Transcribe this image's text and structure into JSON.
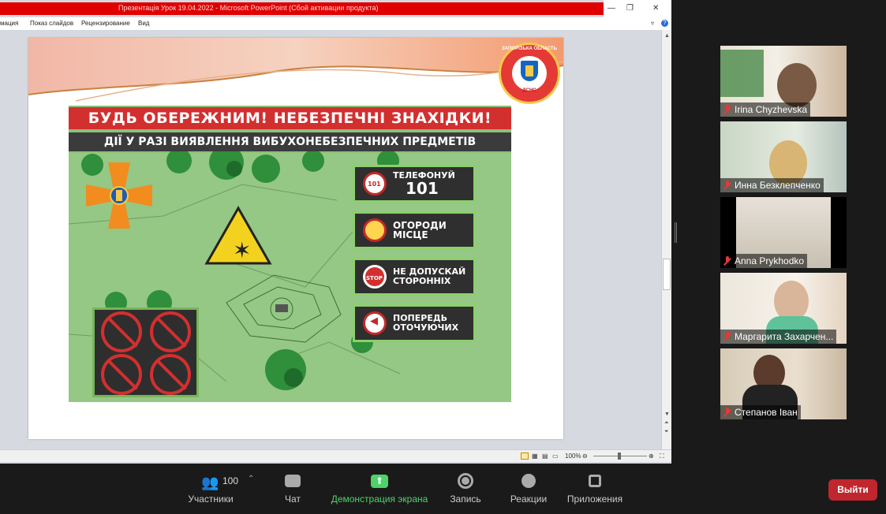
{
  "ppt": {
    "title": "Презентація Урок 19.04.2022  -  Microsoft PowerPoint (Сбой активации продукта)",
    "menu": [
      "мация",
      "Показ слайдов",
      "Рецензирование",
      "Вид"
    ],
    "zoom": "100%"
  },
  "slide": {
    "badge_text": "ЗАПОРІЗЬКА ОБЛАСТЬ",
    "badge_sub": "ДСНС",
    "headline": "БУДЬ ОБЕРЕЖНИМ! НЕБЕЗПЕЧНІ ЗНАХІДКИ!",
    "subheadline": "ДІЇ У РАЗІ ВИЯВЛЕННЯ ВИБУХОНЕБЕЗПЕЧНИХ ПРЕДМЕТІВ",
    "actions": [
      {
        "line1": "ТЕЛЕФОНУЙ",
        "line2": "101",
        "icon": "phone-101"
      },
      {
        "line1": "ОГОРОДИ",
        "line2": "МІСЦЕ",
        "icon": "fence-tape"
      },
      {
        "line1": "НЕ ДОПУСКАЙ",
        "line2": "СТОРОННІХ",
        "icon": "stop-sign",
        "icon_text": "STOP"
      },
      {
        "line1": "ПОПЕРЕДЬ",
        "line2": "ОТОЧУЮЧИХ",
        "icon": "megaphone"
      }
    ],
    "phone_icon_text": "101"
  },
  "participants": [
    {
      "name": "Irina Chyzhevska",
      "muted": true
    },
    {
      "name": "Инна Безклепченко",
      "muted": true
    },
    {
      "name": "Anna Prykhodko",
      "muted": true
    },
    {
      "name": "Маргарита Захарчен...",
      "muted": true
    },
    {
      "name": "Степанов Іван",
      "muted": true
    }
  ],
  "toolbar": {
    "participants_label": "Участники",
    "participants_count": "100",
    "chat_label": "Чат",
    "share_label": "Демонстрация экрана",
    "record_label": "Запись",
    "reactions_label": "Реакции",
    "apps_label": "Приложения",
    "exit_label": "Выйти"
  },
  "colors": {
    "share_green": "#4fd16b",
    "exit_red": "#c0262d",
    "ppt_title_red": "#e00000",
    "poster_red": "#d22f2f",
    "poster_green": "#8cc07a"
  }
}
